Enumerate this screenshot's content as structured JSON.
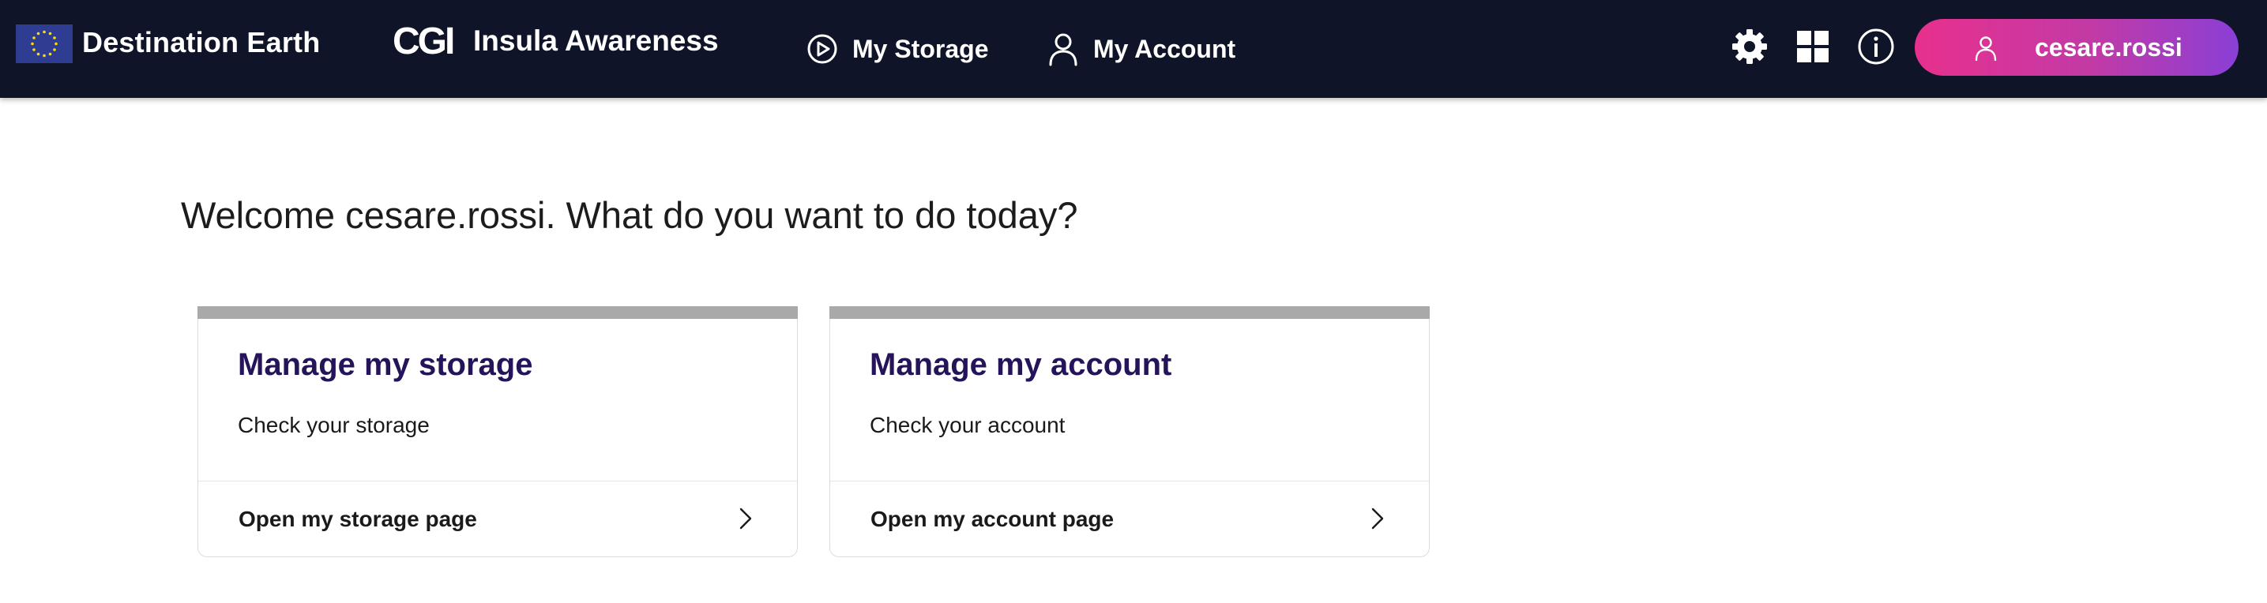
{
  "header": {
    "brand_name": "Destination Earth",
    "partner_logo": "CGI",
    "app_name": "Insula Awareness",
    "nav": [
      {
        "label": "My Storage",
        "icon": "play-circle-icon"
      },
      {
        "label": "My Account",
        "icon": "user-icon"
      }
    ],
    "tools": [
      "gear-icon",
      "apps-grid-icon",
      "info-icon"
    ],
    "user": {
      "name": "cesare.rossi",
      "icon": "user-icon"
    }
  },
  "colors": {
    "header_bg": "#0f1428",
    "user_gradient_start": "#e8308d",
    "user_gradient_end": "#8a3fd6",
    "card_title": "#26145a",
    "eu_blue": "#2e3c92",
    "eu_star": "#ffdd00"
  },
  "main": {
    "welcome": "Welcome cesare.rossi. What do you want to do today?",
    "cards": [
      {
        "title": "Manage my storage",
        "description": "Check your storage",
        "link_label": "Open my storage page"
      },
      {
        "title": "Manage my account",
        "description": "Check your account",
        "link_label": "Open my account page"
      }
    ]
  }
}
